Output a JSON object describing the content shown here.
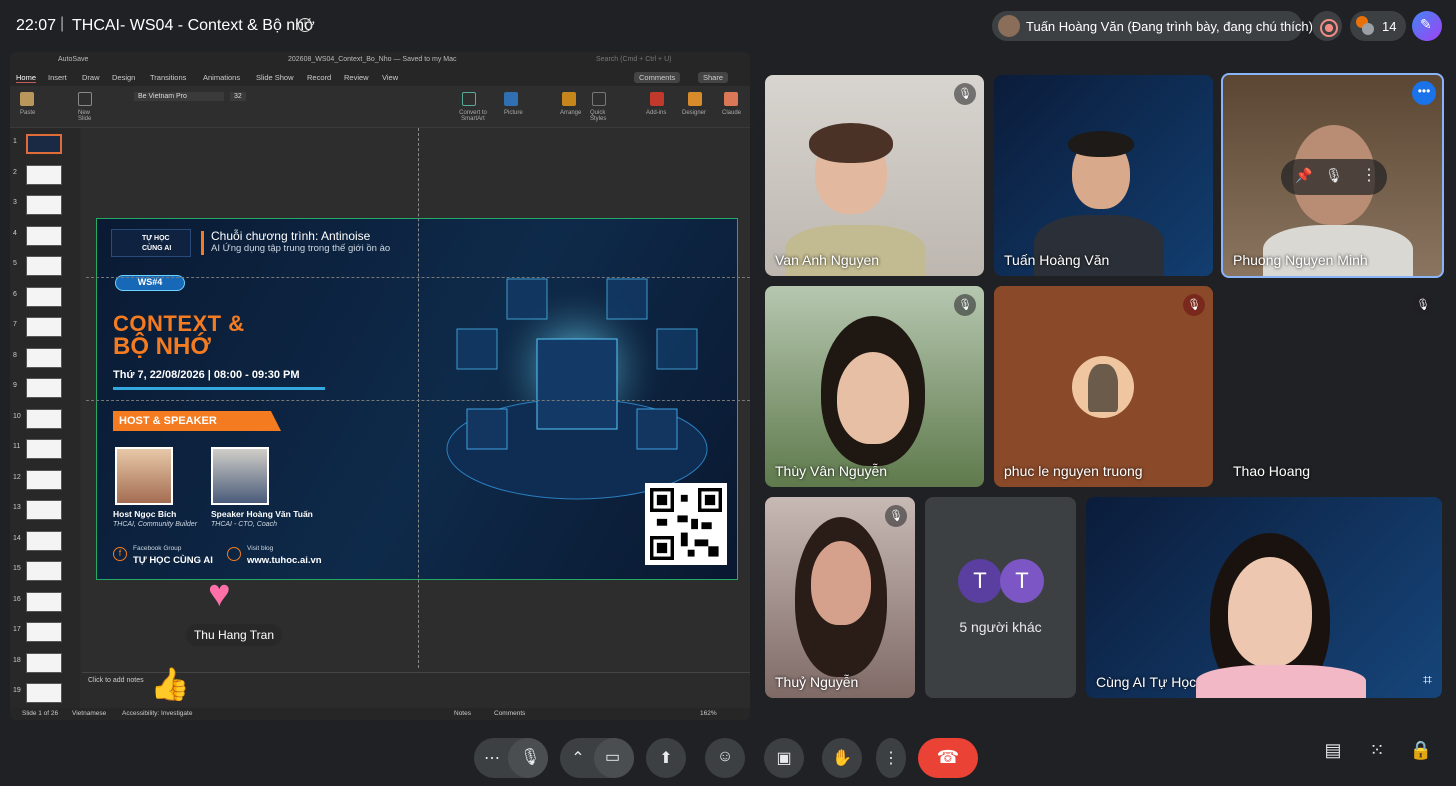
{
  "header": {
    "time": "22:07",
    "separator": "|",
    "meeting_title": "THCAI- WS04 - Context & Bộ nhớ",
    "presenter_status": "Tuấn Hoàng Văn (Đang trình bày, đang chú thích)",
    "participant_count": "14"
  },
  "ppt": {
    "autosave": "AutoSave",
    "file_title": "202608_WS04_Context_Bo_Nho — Saved to my Mac",
    "search_placeholder": "Search (Cmd + Ctrl + U)",
    "tabs": [
      "Home",
      "Insert",
      "Draw",
      "Design",
      "Transitions",
      "Animations",
      "Slide Show",
      "Record",
      "Review",
      "View"
    ],
    "comments_btn": "Comments",
    "share_btn": "Share",
    "font_name": "Be Vietnam Pro",
    "font_size": "32",
    "ribbon": {
      "paste": "Paste",
      "new_slide": "New Slide",
      "convert": "Convert to SmartArt",
      "picture": "Picture",
      "arrange": "Arrange",
      "quick_styles": "Quick Styles",
      "addins": "Add-ins",
      "designer": "Designer",
      "claude": "Claude"
    },
    "thumb_numbers": [
      "1",
      "2",
      "3",
      "4",
      "5",
      "6",
      "7",
      "8",
      "9",
      "10",
      "11",
      "12",
      "13",
      "14",
      "15",
      "16",
      "17",
      "18",
      "19"
    ],
    "notes_placeholder": "Click to add notes",
    "status": {
      "slide": "Slide 1 of 26",
      "language": "Vietnamese",
      "accessibility": "Accessibility: Investigate",
      "notes": "Notes",
      "comments": "Comments",
      "zoom": "162%"
    }
  },
  "slide": {
    "logo": "TỰ HỌC\nCÙNG AI",
    "series_title": "Chuỗi chương trình: Antinoise",
    "series_subtitle": "AI Ứng dụng tập trung trong thế giới ồn ào",
    "ws_badge": "WS#4",
    "title_line1": "CONTEXT &",
    "title_line2": "BỘ NHỚ",
    "date": "Thứ 7, 22/08/2026 | 08:00 - 09:30 PM",
    "host_banner": "HOST & SPEAKER",
    "host_name": "Host Ngọc Bích",
    "host_role": "THCAI, Community Builder",
    "speaker_name": "Speaker Hoàng Văn Tuấn",
    "speaker_role": "THCAI - CTO, Coach",
    "fb_label": "Facebook Group",
    "fb_name": "TỰ HỌC CÙNG AI",
    "blog_label": "Visit blog",
    "blog_url": "www.tuhoc.ai.vn"
  },
  "reaction": {
    "name": "Thu Hang Tran"
  },
  "participants": [
    {
      "name": "Van Anh Nguyen"
    },
    {
      "name": "Tuấn Hoàng Văn"
    },
    {
      "name": "Phuong Nguyen Minh"
    },
    {
      "name": "Thùy Vân Nguyễn"
    },
    {
      "name": "phuc le nguyen truong"
    },
    {
      "name": "Thao Hoang"
    },
    {
      "name": "Thuỷ Nguyễn"
    },
    {
      "name": "5 người khác",
      "initials": [
        "T",
        "T"
      ]
    },
    {
      "name": "Cùng AI Tự Học"
    }
  ],
  "colors": {
    "accent": "#f47b20",
    "end_call": "#ea4335",
    "bg": "#202124"
  },
  "icons": [
    "info-icon",
    "record-icon",
    "people-icon",
    "gemini-icon",
    "mic-icon",
    "camera-icon",
    "present-icon",
    "emoji-icon",
    "captions-icon",
    "hand-icon",
    "more-icon",
    "end-call-icon",
    "chat-icon",
    "activities-icon",
    "host-controls-icon"
  ]
}
